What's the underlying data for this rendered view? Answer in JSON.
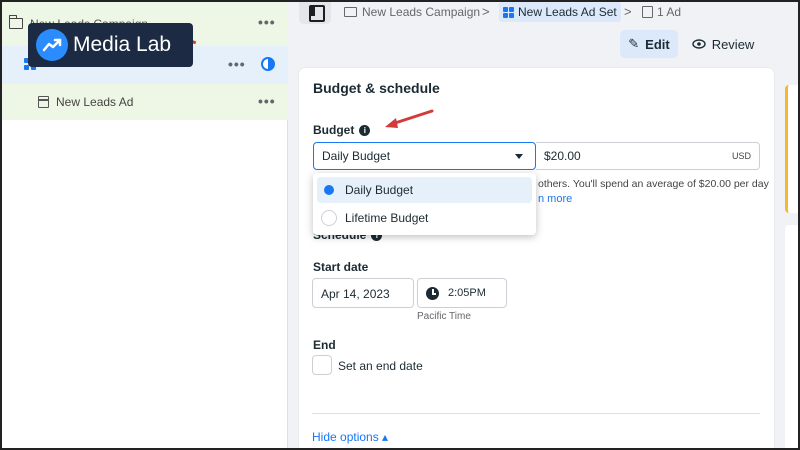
{
  "tree": {
    "campaign_name": "New Leads Campaign",
    "ad_name": "New Leads Ad",
    "more_label": "•••"
  },
  "logo": {
    "text": "Media Lab"
  },
  "breadcrumb": {
    "campaign": "New Leads Campaign",
    "ad_set": "New Leads Ad Set",
    "ad": "1 Ad",
    "separator": ">"
  },
  "actions": {
    "edit_label": "Edit",
    "review_label": "Review"
  },
  "budget_schedule": {
    "title": "Budget & schedule",
    "budget_label": "Budget",
    "budget_type_selected": "Daily Budget",
    "amount": "$20.00",
    "currency": "USD",
    "hint": "others. You'll spend an average of $20.00 per day",
    "learn_more": "n more",
    "options": [
      {
        "label": "Daily Budget",
        "selected": true
      },
      {
        "label": "Lifetime Budget",
        "selected": false
      }
    ],
    "schedule_label": "Schedule",
    "start_date_label": "Start date",
    "start_date": "Apr 14, 2023",
    "start_time": "2:05PM",
    "timezone": "Pacific Time",
    "end_label": "End",
    "end_date_checkbox_label": "Set an end date",
    "end_date_checked": false,
    "hide_options": "Hide options ▴"
  },
  "colors": {
    "accent": "#1877f2",
    "selected_bg": "#e5f0fb",
    "campaign_bg": "#eef7e6",
    "logo_bg": "#1c2a44",
    "annotation_arrow": "#d33b3b"
  }
}
